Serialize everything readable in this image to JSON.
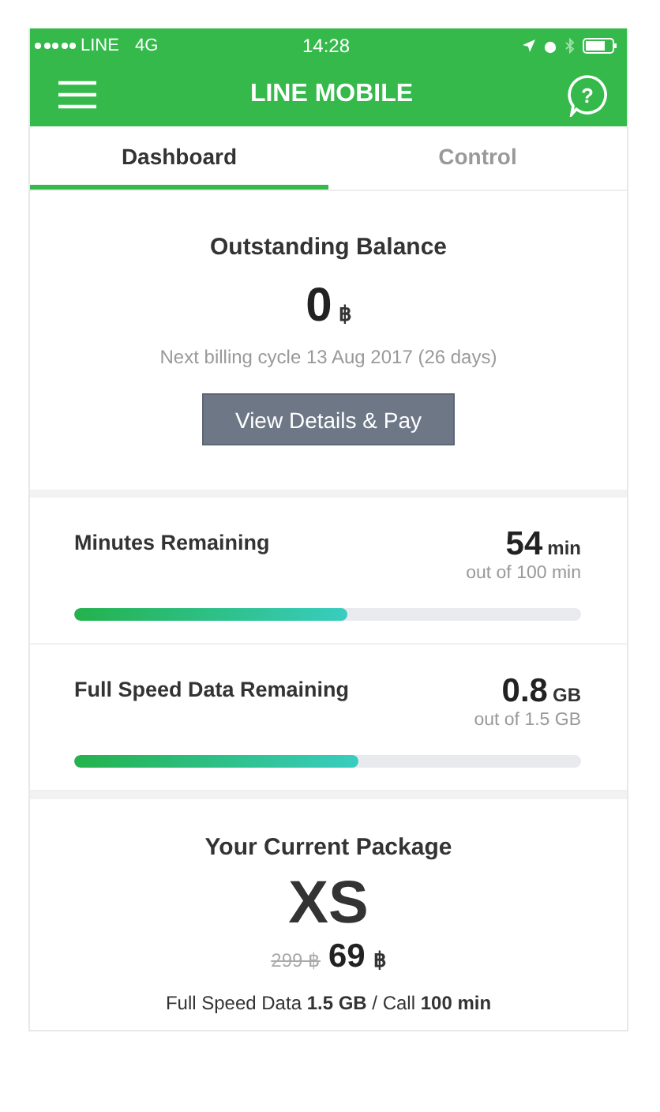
{
  "status_bar": {
    "carrier": "LINE",
    "network": "4G",
    "time": "14:28"
  },
  "nav_bar": {
    "title": "LINE MOBILE",
    "help_icon": "?"
  },
  "tabs": [
    {
      "label": "Dashboard",
      "selected": true
    },
    {
      "label": "Control",
      "selected": false
    }
  ],
  "balance": {
    "title": "Outstanding Balance",
    "amount": "0",
    "currency": "฿",
    "billing_note": "Next billing cycle 13 Aug 2017 (26 days)",
    "button": "View Details & Pay"
  },
  "usage": [
    {
      "title": "Minutes Remaining",
      "value": "54",
      "unit": "min",
      "total": "out of 100 min",
      "level": 0.54
    },
    {
      "title": "Full Speed Data Remaining",
      "value": "0.8",
      "unit": "GB",
      "total": "out of 1.5 GB",
      "level": 0.56
    }
  ],
  "package": {
    "title": "Your Current Package",
    "name": "XS",
    "old_price": "299 ฿",
    "price": "69",
    "currency": "฿",
    "summary": "Full Speed Data **1.5 GB** / Call **100 min**"
  }
}
